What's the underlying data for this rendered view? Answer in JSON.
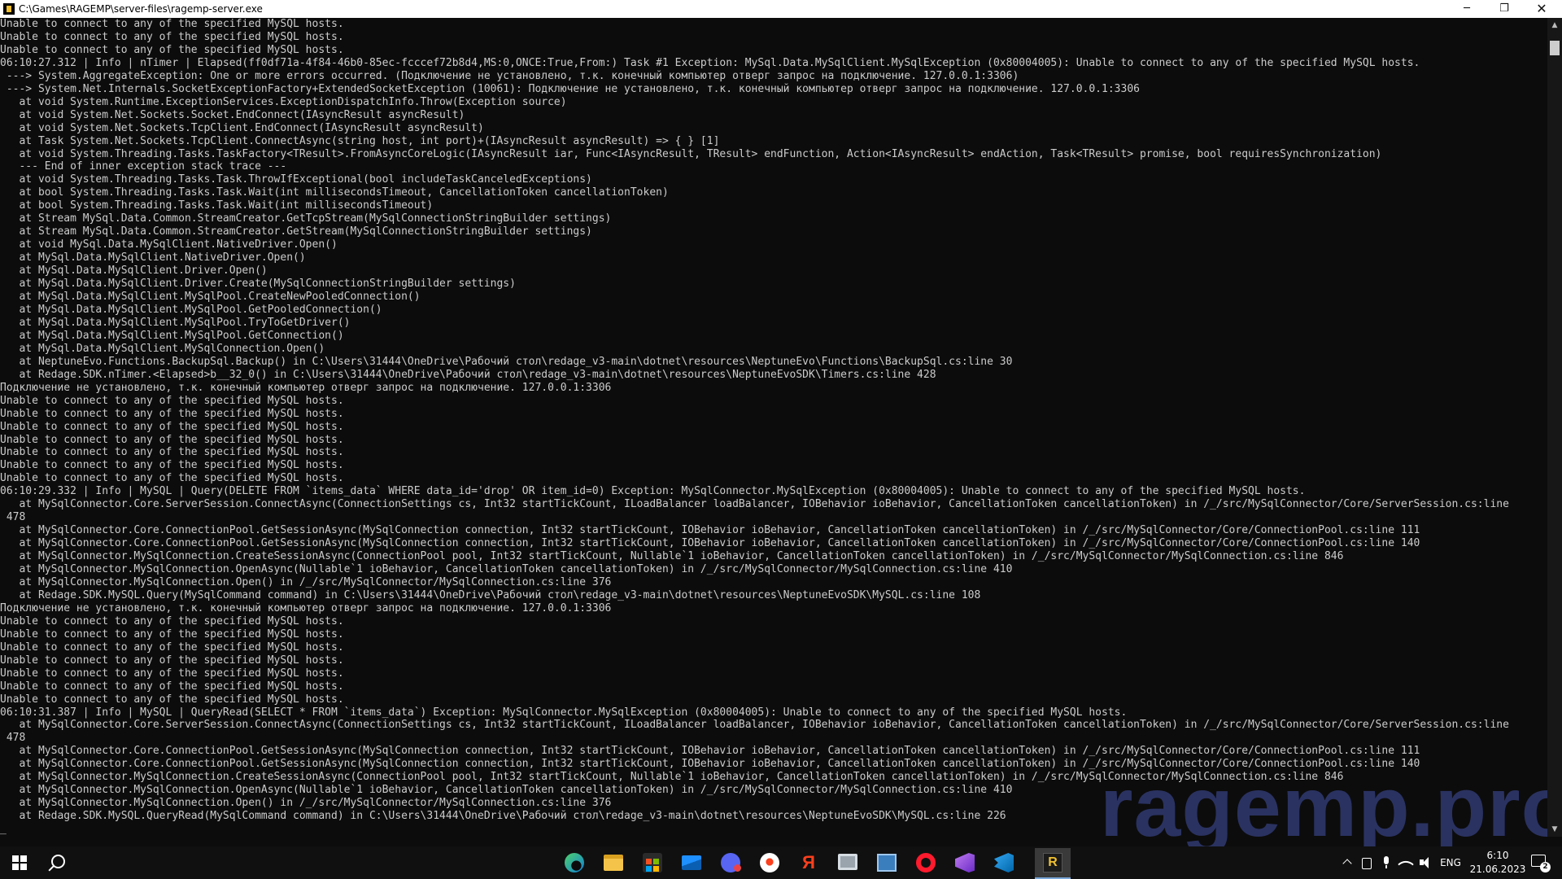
{
  "window": {
    "title": "C:\\Games\\RAGEMP\\server-files\\ragemp-server.exe",
    "minimize_glyph": "─",
    "restore_glyph": "❐",
    "close_glyph": "✕"
  },
  "console": {
    "lines": [
      "Unable to connect to any of the specified MySQL hosts.",
      "Unable to connect to any of the specified MySQL hosts.",
      "Unable to connect to any of the specified MySQL hosts.",
      "06:10:27.312 | Info | nTimer | Elapsed(ff0df71a-4f84-46b0-85ec-fcccef72b8d4,MS:0,ONCE:True,From:) Task #1 Exception: MySql.Data.MySqlClient.MySqlException (0x80004005): Unable to connect to any of the specified MySQL hosts.",
      " ---> System.AggregateException: One or more errors occurred. (Подключение не установлено, т.к. конечный компьютер отверг запрос на подключение. 127.0.0.1:3306)",
      " ---> System.Net.Internals.SocketExceptionFactory+ExtendedSocketException (10061): Подключение не установлено, т.к. конечный компьютер отверг запрос на подключение. 127.0.0.1:3306",
      "   at void System.Runtime.ExceptionServices.ExceptionDispatchInfo.Throw(Exception source)",
      "   at void System.Net.Sockets.Socket.EndConnect(IAsyncResult asyncResult)",
      "   at void System.Net.Sockets.TcpClient.EndConnect(IAsyncResult asyncResult)",
      "   at Task System.Net.Sockets.TcpClient.ConnectAsync(string host, int port)+(IAsyncResult asyncResult) => { } [1]",
      "   at void System.Threading.Tasks.TaskFactory<TResult>.FromAsyncCoreLogic(IAsyncResult iar, Func<IAsyncResult, TResult> endFunction, Action<IAsyncResult> endAction, Task<TResult> promise, bool requiresSynchronization)",
      "   --- End of inner exception stack trace ---",
      "   at void System.Threading.Tasks.Task.ThrowIfExceptional(bool includeTaskCanceledExceptions)",
      "   at bool System.Threading.Tasks.Task.Wait(int millisecondsTimeout, CancellationToken cancellationToken)",
      "   at bool System.Threading.Tasks.Task.Wait(int millisecondsTimeout)",
      "   at Stream MySql.Data.Common.StreamCreator.GetTcpStream(MySqlConnectionStringBuilder settings)",
      "   at Stream MySql.Data.Common.StreamCreator.GetStream(MySqlConnectionStringBuilder settings)",
      "   at void MySql.Data.MySqlClient.NativeDriver.Open()",
      "   at MySql.Data.MySqlClient.NativeDriver.Open()",
      "   at MySql.Data.MySqlClient.Driver.Open()",
      "   at MySql.Data.MySqlClient.Driver.Create(MySqlConnectionStringBuilder settings)",
      "   at MySql.Data.MySqlClient.MySqlPool.CreateNewPooledConnection()",
      "   at MySql.Data.MySqlClient.MySqlPool.GetPooledConnection()",
      "   at MySql.Data.MySqlClient.MySqlPool.TryToGetDriver()",
      "   at MySql.Data.MySqlClient.MySqlPool.GetConnection()",
      "   at MySql.Data.MySqlClient.MySqlConnection.Open()",
      "   at NeptuneEvo.Functions.BackupSql.Backup() in C:\\Users\\31444\\OneDrive\\Рабочий стол\\redage_v3-main\\dotnet\\resources\\NeptuneEvo\\Functions\\BackupSql.cs:line 30",
      "   at Redage.SDK.nTimer.<Elapsed>b__32_0() in C:\\Users\\31444\\OneDrive\\Рабочий стол\\redage_v3-main\\dotnet\\resources\\NeptuneEvoSDK\\Timers.cs:line 428",
      "Подключение не установлено, т.к. конечный компьютер отверг запрос на подключение. 127.0.0.1:3306",
      "Unable to connect to any of the specified MySQL hosts.",
      "Unable to connect to any of the specified MySQL hosts.",
      "Unable to connect to any of the specified MySQL hosts.",
      "Unable to connect to any of the specified MySQL hosts.",
      "Unable to connect to any of the specified MySQL hosts.",
      "Unable to connect to any of the specified MySQL hosts.",
      "Unable to connect to any of the specified MySQL hosts.",
      "06:10:29.332 | Info | MySQL | Query(DELETE FROM `items_data` WHERE data_id='drop' OR item_id=0) Exception: MySqlConnector.MySqlException (0x80004005): Unable to connect to any of the specified MySQL hosts.",
      "   at MySqlConnector.Core.ServerSession.ConnectAsync(ConnectionSettings cs, Int32 startTickCount, ILoadBalancer loadBalancer, IOBehavior ioBehavior, CancellationToken cancellationToken) in /_/src/MySqlConnector/Core/ServerSession.cs:line",
      " 478",
      "   at MySqlConnector.Core.ConnectionPool.GetSessionAsync(MySqlConnection connection, Int32 startTickCount, IOBehavior ioBehavior, CancellationToken cancellationToken) in /_/src/MySqlConnector/Core/ConnectionPool.cs:line 111",
      "   at MySqlConnector.Core.ConnectionPool.GetSessionAsync(MySqlConnection connection, Int32 startTickCount, IOBehavior ioBehavior, CancellationToken cancellationToken) in /_/src/MySqlConnector/Core/ConnectionPool.cs:line 140",
      "   at MySqlConnector.MySqlConnection.CreateSessionAsync(ConnectionPool pool, Int32 startTickCount, Nullable`1 ioBehavior, CancellationToken cancellationToken) in /_/src/MySqlConnector/MySqlConnection.cs:line 846",
      "   at MySqlConnector.MySqlConnection.OpenAsync(Nullable`1 ioBehavior, CancellationToken cancellationToken) in /_/src/MySqlConnector/MySqlConnection.cs:line 410",
      "   at MySqlConnector.MySqlConnection.Open() in /_/src/MySqlConnector/MySqlConnection.cs:line 376",
      "   at Redage.SDK.MySQL.Query(MySqlCommand command) in C:\\Users\\31444\\OneDrive\\Рабочий стол\\redage_v3-main\\dotnet\\resources\\NeptuneEvoSDK\\MySQL.cs:line 108",
      "Подключение не установлено, т.к. конечный компьютер отверг запрос на подключение. 127.0.0.1:3306",
      "Unable to connect to any of the specified MySQL hosts.",
      "Unable to connect to any of the specified MySQL hosts.",
      "Unable to connect to any of the specified MySQL hosts.",
      "Unable to connect to any of the specified MySQL hosts.",
      "Unable to connect to any of the specified MySQL hosts.",
      "Unable to connect to any of the specified MySQL hosts.",
      "Unable to connect to any of the specified MySQL hosts.",
      "06:10:31.387 | Info | MySQL | QueryRead(SELECT * FROM `items_data`) Exception: MySqlConnector.MySqlException (0x80004005): Unable to connect to any of the specified MySQL hosts.",
      "   at MySqlConnector.Core.ServerSession.ConnectAsync(ConnectionSettings cs, Int32 startTickCount, ILoadBalancer loadBalancer, IOBehavior ioBehavior, CancellationToken cancellationToken) in /_/src/MySqlConnector/Core/ServerSession.cs:line",
      " 478",
      "   at MySqlConnector.Core.ConnectionPool.GetSessionAsync(MySqlConnection connection, Int32 startTickCount, IOBehavior ioBehavior, CancellationToken cancellationToken) in /_/src/MySqlConnector/Core/ConnectionPool.cs:line 111",
      "   at MySqlConnector.Core.ConnectionPool.GetSessionAsync(MySqlConnection connection, Int32 startTickCount, IOBehavior ioBehavior, CancellationToken cancellationToken) in /_/src/MySqlConnector/Core/ConnectionPool.cs:line 140",
      "   at MySqlConnector.MySqlConnection.CreateSessionAsync(ConnectionPool pool, Int32 startTickCount, Nullable`1 ioBehavior, CancellationToken cancellationToken) in /_/src/MySqlConnector/MySqlConnection.cs:line 846",
      "   at MySqlConnector.MySqlConnection.OpenAsync(Nullable`1 ioBehavior, CancellationToken cancellationToken) in /_/src/MySqlConnector/MySqlConnection.cs:line 410",
      "   at MySqlConnector.MySqlConnection.Open() in /_/src/MySqlConnector/MySqlConnection.cs:line 376",
      "   at Redage.SDK.MySQL.QueryRead(MySqlCommand command) in C:\\Users\\31444\\OneDrive\\Рабочий стол\\redage_v3-main\\dotnet\\resources\\NeptuneEvoSDK\\MySQL.cs:line 226",
      "_"
    ]
  },
  "watermark": "ragemp.pro",
  "taskbar": {
    "pinned_apps": [
      "start-icon",
      "search-icon",
      "edge-icon",
      "file-explorer-icon",
      "store-icon",
      "mail-icon",
      "discord-icon",
      "yandex-browser-icon",
      "yandex-icon",
      "remote-desktop-icon",
      "terminal-icon",
      "opera-icon",
      "visual-studio-icon",
      "vscode-icon",
      "ragemp-icon"
    ],
    "yandex_glyph": "Я",
    "ragemp_glyph": "R",
    "language": "ENG",
    "time": "6:10",
    "date": "21.06.2023",
    "notification_count": "2"
  },
  "colors": {
    "console_background": "#0c0c0c",
    "console_text": "#cccccc",
    "taskbar": "#101010",
    "watermark": "#2e376b"
  }
}
